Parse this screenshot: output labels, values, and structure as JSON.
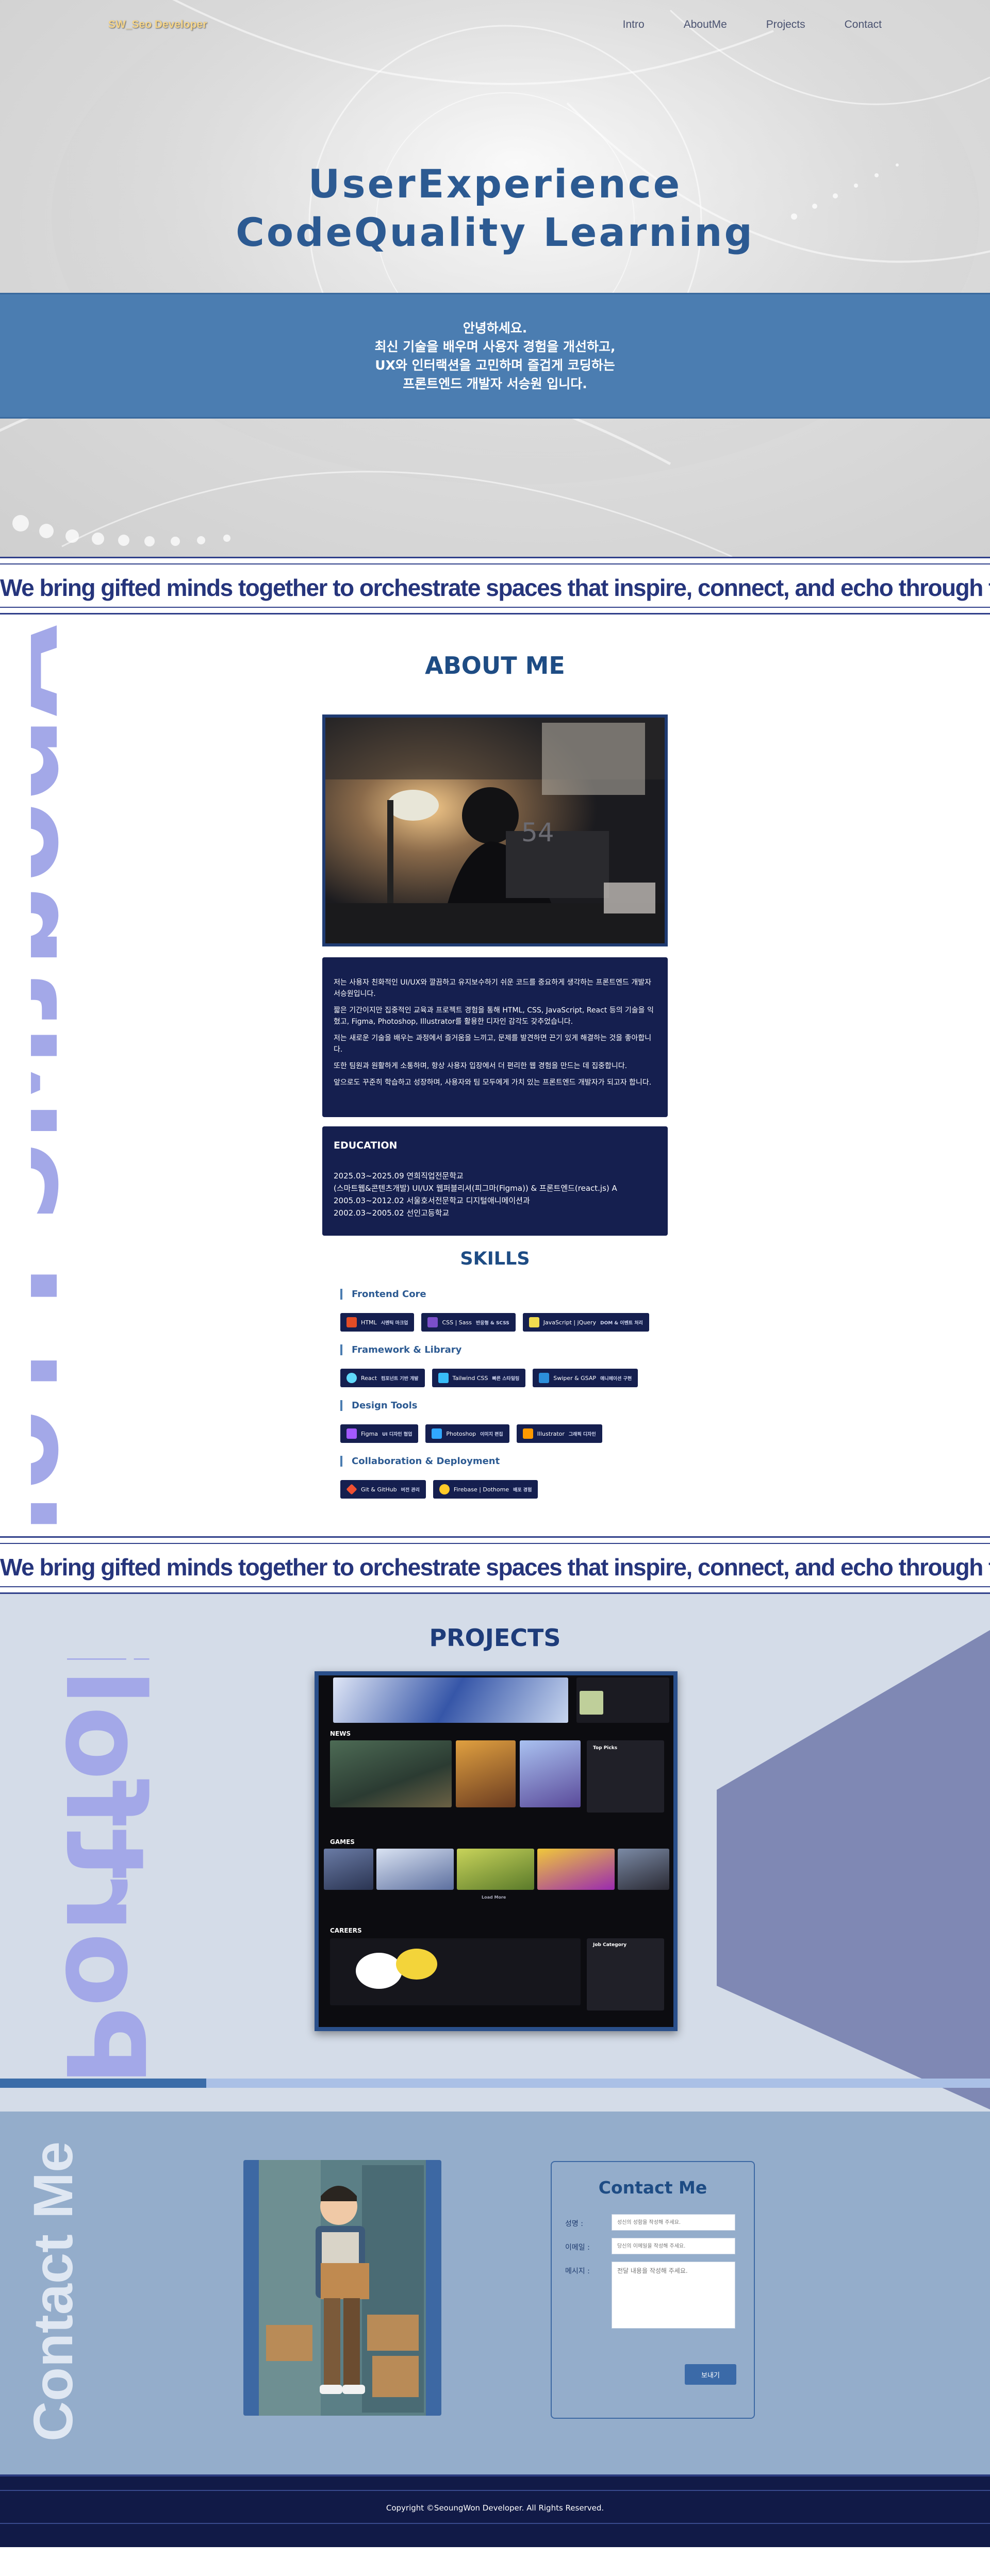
{
  "header": {
    "logo": "SW_Seo Developer",
    "nav": [
      "Intro",
      "AboutMe",
      "Projects",
      "Contact"
    ]
  },
  "hero": {
    "title_line1": "UserExperience",
    "title_line2": "CodeQuality Learning",
    "intro": [
      "안녕하세요.",
      "최신 기술을 배우며 사용자 경험을 개선하고,",
      "UX와 인터랙션을 고민하며 즐겁게 코딩하는",
      "프론트엔드 개발자 서승원 입니다."
    ]
  },
  "marquee": {
    "text": "We bring gifted minds together to orchestrate spaces that inspire, connect, and echo through time"
  },
  "about": {
    "vertical_text": "AboutMe Profile",
    "title": "ABOUT ME",
    "photo_alt": "developer-at-desk-photo",
    "paragraphs": [
      "저는 사용자 친화적인 UI/UX와 깔끔하고 유지보수하기 쉬운 코드를 중요하게 생각하는 프론트엔드 개발자 서승원입니다.",
      "짧은 기간이지만 집중적인 교육과 프로젝트 경험을 통해 HTML, CSS, JavaScript, React 등의 기술을 익혔고, Figma, Photoshop, Illustrator를 활용한 디자인 감각도 갖추었습니다.",
      "저는 새로운 기술을 배우는 과정에서 즐거움을 느끼고, 문제를 발견하면 끈기 있게 해결하는 것을 좋아합니다.",
      "또한 팀원과 원활하게 소통하며, 항상 사용자 입장에서 더 편리한 웹 경험을 만드는 데 집중합니다.",
      "앞으로도 꾸준히 학습하고 성장하며, 사용자와 팀 모두에게 가치 있는 프론트엔드 개발자가 되고자 합니다."
    ],
    "education_title": "EDUCATION",
    "education": [
      "2025.03~2025.09 연희직업전문학교",
      "(스마트웹&콘텐츠개발) UI/UX 웹퍼블리셔(피그마(Figma)) & 프론트엔드(react.js) A",
      "2005.03~2012.02 서울호서전문학교 디지털애니메이션과",
      "2002.03~2005.02 선인고등학교"
    ]
  },
  "skills": {
    "title": "SKILLS",
    "groups": [
      {
        "name": "Frontend Core",
        "items": [
          {
            "label": "HTML",
            "sub": "시멘틱 마크업",
            "icon": "html-icon",
            "color": "#e44d26"
          },
          {
            "label": "CSS | Sass",
            "sub": "반응형 & SCSS",
            "icon": "css-icon",
            "color": "#7b4fc9"
          },
          {
            "label": "JavaScript | jQuery",
            "sub": "DOM & 이벤트 처리",
            "icon": "js-icon",
            "color": "#f0db4f"
          }
        ]
      },
      {
        "name": "Framework & Library",
        "items": [
          {
            "label": "React",
            "sub": "컴포넌트 기반 개발",
            "icon": "react-icon",
            "color": "#61dafb"
          },
          {
            "label": "Tailwind CSS",
            "sub": "빠른 스타일링",
            "icon": "tailwind-icon",
            "color": "#38bdf8"
          },
          {
            "label": "Swiper & GSAP",
            "sub": "애니메이션 구현",
            "icon": "swiper-icon",
            "color": "#2c8fdb"
          }
        ]
      },
      {
        "name": "Design Tools",
        "items": [
          {
            "label": "Figma",
            "sub": "UI 디자인 협업",
            "icon": "figma-icon",
            "color": "#a259ff"
          },
          {
            "label": "Photoshop",
            "sub": "이미지 편집",
            "icon": "photoshop-icon",
            "color": "#31a8ff"
          },
          {
            "label": "Illustrator",
            "sub": "그래픽 디자인",
            "icon": "illustrator-icon",
            "color": "#ff9a00"
          }
        ]
      },
      {
        "name": "Collaboration & Deployment",
        "items": [
          {
            "label": "Git & GitHub",
            "sub": "버전 관리",
            "icon": "git-icon",
            "color": "#f05032"
          },
          {
            "label": "Firebase | Dothome",
            "sub": "배포 경험",
            "icon": "firebase-icon",
            "color": "#ffca28"
          }
        ]
      }
    ]
  },
  "projects": {
    "title": "PROJECTS",
    "vertical_text": "Portfolio",
    "preview_sections": [
      "NEWS",
      "GAMES",
      "CAREERS"
    ],
    "preview_top_picks": "Top Picks",
    "preview_job_category": "Job Category",
    "preview_load_more": "Load More"
  },
  "contact": {
    "vertical_text": "Contact Me",
    "title": "Contact Me",
    "fields": [
      {
        "label": "성명 :",
        "placeholder": "성신의 성함을 작성해 주세요."
      },
      {
        "label": "이메일 :",
        "placeholder": "당신의 이메일을 작성해 주세요."
      }
    ],
    "message_label": "메시지 :",
    "message_placeholder": "전달 내용을 작성해 주세요.",
    "submit_label": "보내기"
  },
  "footer": {
    "copyright": "Copyright ©SeoungWon Developer. All Rights Reserved."
  },
  "colors": {
    "primary": "#1e4c84",
    "band": "#4b7db1",
    "navy": "#151f4f",
    "projects_bg": "#d4dce8",
    "contact_bg": "#94adcb",
    "footer_bg": "#111a47",
    "vertical_about": "#a3a8e8"
  }
}
